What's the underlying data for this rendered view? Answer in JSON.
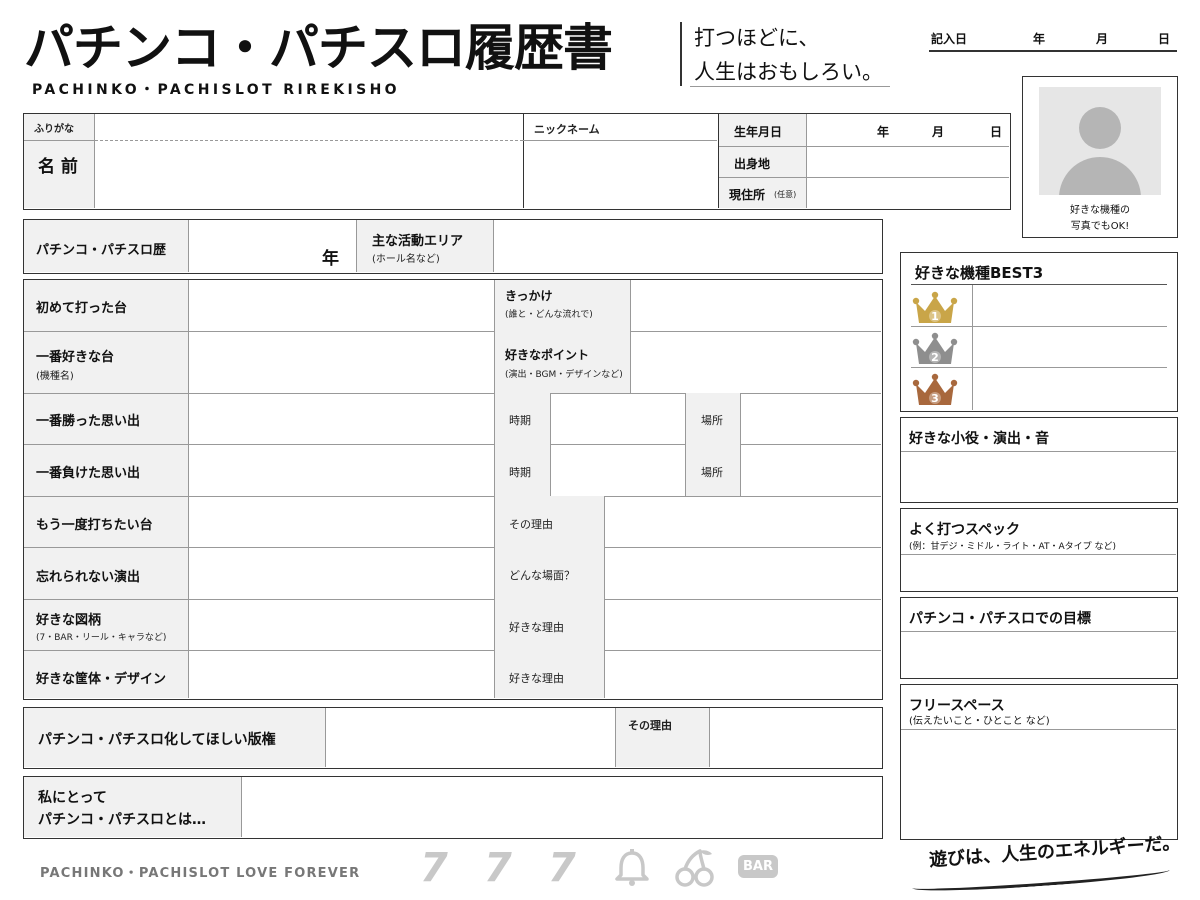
{
  "header": {
    "title": "パチンコ・パチスロ履歴書",
    "title_roman": "PACHINKO・PACHISLOT  RIREKISHO",
    "catch_line1": "打つほどに、",
    "catch_line2": "人生はおもしろい。",
    "date_label": "記入日",
    "year": "年",
    "month": "月",
    "day": "日"
  },
  "profile": {
    "furigana": "ふりがな",
    "name": "名 前",
    "nickname": "ニックネーム",
    "birthdate": "生年月日",
    "year": "年",
    "month": "月",
    "day": "日",
    "birthplace": "出身地",
    "address": "現住所",
    "address_note": "(任意)"
  },
  "photo": {
    "icon": "person-silhouette-icon",
    "caption_line1": "好きな機種の",
    "caption_line2": "写真でもOK!"
  },
  "history": {
    "career_label": "パチンコ・パチスロ歴",
    "career_unit": "年",
    "area_label": "主な活動エリア",
    "area_note": "(ホール名など)"
  },
  "rows": {
    "first_machine": "初めて打った台",
    "trigger": "きっかけ",
    "trigger_note": "(誰と・どんな流れで)",
    "favorite_machine": "一番好きな台",
    "favorite_machine_note": "(機種名)",
    "favorite_point": "好きなポイント",
    "favorite_point_note": "(演出・BGM・デザインなど)",
    "best_win": "一番勝った思い出",
    "worst_loss": "一番負けた思い出",
    "period": "時期",
    "place": "場所",
    "play_again": "もう一度打ちたい台",
    "reason": "その理由",
    "unforgettable": "忘れられない演出",
    "which_scene": "どんな場面？",
    "favorite_symbol": "好きな図柄",
    "favorite_symbol_note": "(7・BAR・リール・キャラなど)",
    "favorite_reason": "好きな理由",
    "favorite_cabinet": "好きな筐体・デザイン",
    "license_wish": "パチンコ・パチスロ化してほしい版権",
    "license_reason": "その理由",
    "to_me_line1": "私にとって",
    "to_me_line2": "パチンコ・パチスロとは…"
  },
  "sidebar": {
    "best3_title": "好きな機種BEST3",
    "ranks": [
      "1",
      "2",
      "3"
    ],
    "rank_colors": [
      "#c9a548",
      "#8e8e8e",
      "#a8683d"
    ],
    "rank_icons": [
      "gold-crown-icon",
      "silver-crown-icon",
      "bronze-crown-icon"
    ],
    "small_roles": "好きな小役・演出・音",
    "spec_title": "よく打つスペック",
    "spec_note": "(例：甘デジ・ミドル・ライト・AT・Aタイプ など)",
    "goal": "パチンコ・パチスロでの目標",
    "free_title": "フリースペース",
    "free_note": "(伝えたいこと・ひとこと など)"
  },
  "footer": {
    "left_text": "PACHINKO・PACHISLOT  LOVE FOREVER",
    "sevens": [
      "7",
      "7",
      "7"
    ],
    "icons": [
      "bell-icon",
      "cherry-icon"
    ],
    "bar": "BAR",
    "right_text": "遊びは、人生のエネルギーだ。"
  }
}
